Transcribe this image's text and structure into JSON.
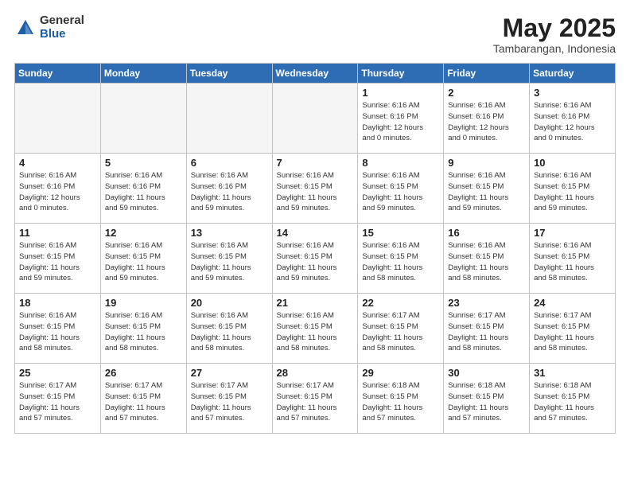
{
  "header": {
    "logo_general": "General",
    "logo_blue": "Blue",
    "month_title": "May 2025",
    "location": "Tambarangan, Indonesia"
  },
  "days_of_week": [
    "Sunday",
    "Monday",
    "Tuesday",
    "Wednesday",
    "Thursday",
    "Friday",
    "Saturday"
  ],
  "weeks": [
    [
      {
        "day": "",
        "info": ""
      },
      {
        "day": "",
        "info": ""
      },
      {
        "day": "",
        "info": ""
      },
      {
        "day": "",
        "info": ""
      },
      {
        "day": "1",
        "info": "Sunrise: 6:16 AM\nSunset: 6:16 PM\nDaylight: 12 hours\nand 0 minutes."
      },
      {
        "day": "2",
        "info": "Sunrise: 6:16 AM\nSunset: 6:16 PM\nDaylight: 12 hours\nand 0 minutes."
      },
      {
        "day": "3",
        "info": "Sunrise: 6:16 AM\nSunset: 6:16 PM\nDaylight: 12 hours\nand 0 minutes."
      }
    ],
    [
      {
        "day": "4",
        "info": "Sunrise: 6:16 AM\nSunset: 6:16 PM\nDaylight: 12 hours\nand 0 minutes."
      },
      {
        "day": "5",
        "info": "Sunrise: 6:16 AM\nSunset: 6:16 PM\nDaylight: 11 hours\nand 59 minutes."
      },
      {
        "day": "6",
        "info": "Sunrise: 6:16 AM\nSunset: 6:16 PM\nDaylight: 11 hours\nand 59 minutes."
      },
      {
        "day": "7",
        "info": "Sunrise: 6:16 AM\nSunset: 6:15 PM\nDaylight: 11 hours\nand 59 minutes."
      },
      {
        "day": "8",
        "info": "Sunrise: 6:16 AM\nSunset: 6:15 PM\nDaylight: 11 hours\nand 59 minutes."
      },
      {
        "day": "9",
        "info": "Sunrise: 6:16 AM\nSunset: 6:15 PM\nDaylight: 11 hours\nand 59 minutes."
      },
      {
        "day": "10",
        "info": "Sunrise: 6:16 AM\nSunset: 6:15 PM\nDaylight: 11 hours\nand 59 minutes."
      }
    ],
    [
      {
        "day": "11",
        "info": "Sunrise: 6:16 AM\nSunset: 6:15 PM\nDaylight: 11 hours\nand 59 minutes."
      },
      {
        "day": "12",
        "info": "Sunrise: 6:16 AM\nSunset: 6:15 PM\nDaylight: 11 hours\nand 59 minutes."
      },
      {
        "day": "13",
        "info": "Sunrise: 6:16 AM\nSunset: 6:15 PM\nDaylight: 11 hours\nand 59 minutes."
      },
      {
        "day": "14",
        "info": "Sunrise: 6:16 AM\nSunset: 6:15 PM\nDaylight: 11 hours\nand 59 minutes."
      },
      {
        "day": "15",
        "info": "Sunrise: 6:16 AM\nSunset: 6:15 PM\nDaylight: 11 hours\nand 58 minutes."
      },
      {
        "day": "16",
        "info": "Sunrise: 6:16 AM\nSunset: 6:15 PM\nDaylight: 11 hours\nand 58 minutes."
      },
      {
        "day": "17",
        "info": "Sunrise: 6:16 AM\nSunset: 6:15 PM\nDaylight: 11 hours\nand 58 minutes."
      }
    ],
    [
      {
        "day": "18",
        "info": "Sunrise: 6:16 AM\nSunset: 6:15 PM\nDaylight: 11 hours\nand 58 minutes."
      },
      {
        "day": "19",
        "info": "Sunrise: 6:16 AM\nSunset: 6:15 PM\nDaylight: 11 hours\nand 58 minutes."
      },
      {
        "day": "20",
        "info": "Sunrise: 6:16 AM\nSunset: 6:15 PM\nDaylight: 11 hours\nand 58 minutes."
      },
      {
        "day": "21",
        "info": "Sunrise: 6:16 AM\nSunset: 6:15 PM\nDaylight: 11 hours\nand 58 minutes."
      },
      {
        "day": "22",
        "info": "Sunrise: 6:17 AM\nSunset: 6:15 PM\nDaylight: 11 hours\nand 58 minutes."
      },
      {
        "day": "23",
        "info": "Sunrise: 6:17 AM\nSunset: 6:15 PM\nDaylight: 11 hours\nand 58 minutes."
      },
      {
        "day": "24",
        "info": "Sunrise: 6:17 AM\nSunset: 6:15 PM\nDaylight: 11 hours\nand 58 minutes."
      }
    ],
    [
      {
        "day": "25",
        "info": "Sunrise: 6:17 AM\nSunset: 6:15 PM\nDaylight: 11 hours\nand 57 minutes."
      },
      {
        "day": "26",
        "info": "Sunrise: 6:17 AM\nSunset: 6:15 PM\nDaylight: 11 hours\nand 57 minutes."
      },
      {
        "day": "27",
        "info": "Sunrise: 6:17 AM\nSunset: 6:15 PM\nDaylight: 11 hours\nand 57 minutes."
      },
      {
        "day": "28",
        "info": "Sunrise: 6:17 AM\nSunset: 6:15 PM\nDaylight: 11 hours\nand 57 minutes."
      },
      {
        "day": "29",
        "info": "Sunrise: 6:18 AM\nSunset: 6:15 PM\nDaylight: 11 hours\nand 57 minutes."
      },
      {
        "day": "30",
        "info": "Sunrise: 6:18 AM\nSunset: 6:15 PM\nDaylight: 11 hours\nand 57 minutes."
      },
      {
        "day": "31",
        "info": "Sunrise: 6:18 AM\nSunset: 6:15 PM\nDaylight: 11 hours\nand 57 minutes."
      }
    ]
  ]
}
